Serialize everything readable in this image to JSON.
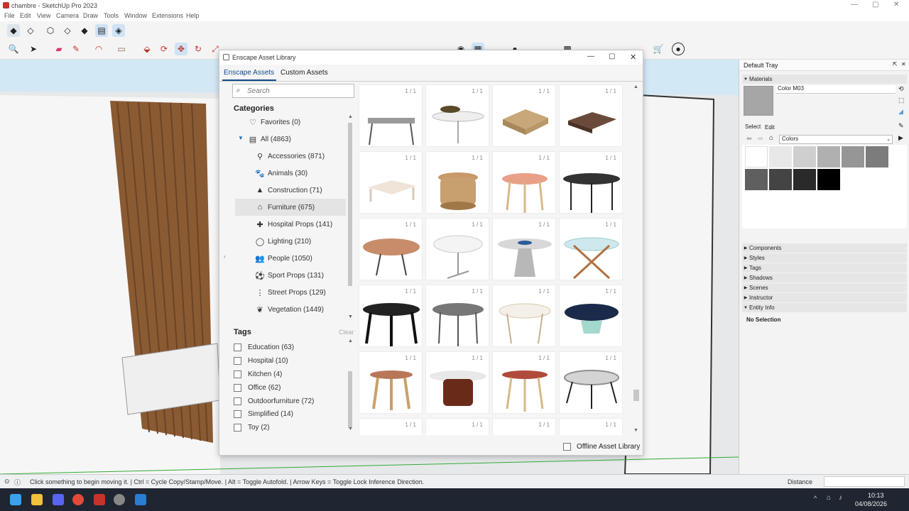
{
  "window": {
    "title": "chambre - SketchUp Pro 2023"
  },
  "menu": [
    "File",
    "Edit",
    "View",
    "Camera",
    "Draw",
    "Tools",
    "Window",
    "Extensions",
    "Help"
  ],
  "dialog": {
    "title": "Enscape Asset Library",
    "tabs": [
      "Enscape Assets",
      "Custom Assets"
    ],
    "search_placeholder": "Search",
    "categories_heading": "Categories",
    "categories": [
      {
        "label": "Favorites (0)",
        "icon": "heart-icon"
      },
      {
        "label": "All (4863)",
        "icon": "list-icon"
      },
      {
        "label": "Accessories (871)",
        "icon": "accessories-icon"
      },
      {
        "label": "Animals (30)",
        "icon": "paw-icon"
      },
      {
        "label": "Construction (71)",
        "icon": "cone-icon"
      },
      {
        "label": "Furniture (675)",
        "icon": "lamp-icon"
      },
      {
        "label": "Hospital Props (141)",
        "icon": "medkit-icon"
      },
      {
        "label": "Lighting (210)",
        "icon": "bulb-icon"
      },
      {
        "label": "People (1050)",
        "icon": "people-icon"
      },
      {
        "label": "Sport Props (131)",
        "icon": "ball-icon"
      },
      {
        "label": "Street Props (129)",
        "icon": "street-icon"
      },
      {
        "label": "Vegetation (1449)",
        "icon": "plant-icon"
      }
    ],
    "tags_heading": "Tags",
    "tags_clear": "Clear",
    "tags": [
      "Education (63)",
      "Hospital (10)",
      "Kitchen (4)",
      "Office (62)",
      "Outdoorfurniture (72)",
      "Simplified (14)",
      "Toy (2)"
    ],
    "asset_page_label": "1 / 1",
    "offline_label": "Offline Asset Library"
  },
  "tray": {
    "title": "Default Tray",
    "materials_label": "Materials",
    "material_name": "Color M03",
    "select_label": "Select",
    "edit_label": "Edit",
    "library": "Colors",
    "swatches": [
      "#ffffff",
      "#e8e8e8",
      "#cfcfcf",
      "#b0b0b0",
      "#969696",
      "#7c7c7c",
      "#5f5f5f",
      "#444444",
      "#2a2a2a",
      "#000000"
    ],
    "sections": [
      "Components",
      "Styles",
      "Tags",
      "Shadows",
      "Scenes",
      "Instructor",
      "Entity Info"
    ],
    "entity_info": "No Selection"
  },
  "status": {
    "message": "Click something to begin moving it. | Ctrl = Cycle Copy/Stamp/Move. | Alt = Toggle Autofold. | Arrow Keys = Toggle Lock Inference Direction.",
    "measure_label": "Distance"
  },
  "clock": {
    "time": "10:13",
    "date": "04/08/2026"
  }
}
